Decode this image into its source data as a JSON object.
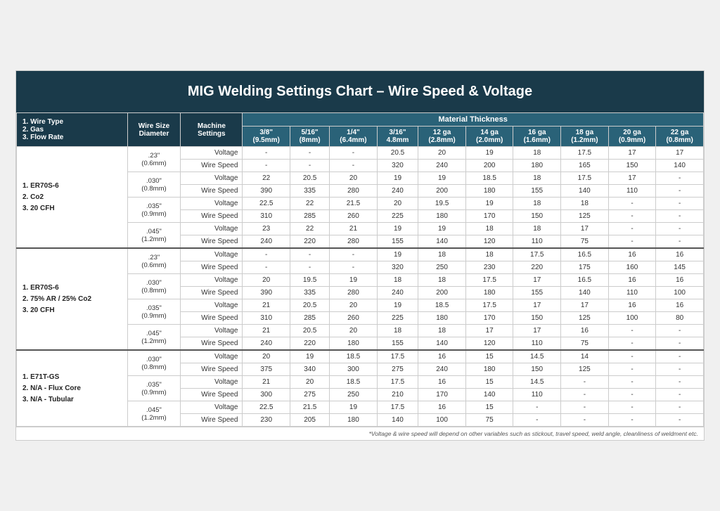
{
  "title": "MIG Welding Settings Chart – Wire Speed & Voltage",
  "headers": {
    "col1": "1. Wire Type\n2. Gas\n3. Flow Rate",
    "col2_line1": "Wire Size",
    "col2_line2": "Diameter",
    "col3_line1": "Machine",
    "col3_line2": "Settings",
    "material_thickness": "Material Thickness",
    "thicknesses": [
      {
        "top": "3/8\"",
        "bottom": "(9.5mm)"
      },
      {
        "top": "5/16\"",
        "bottom": "(8mm)"
      },
      {
        "top": "1/4\"",
        "bottom": "(6.4mm)"
      },
      {
        "top": "3/16\"",
        "bottom": "4.8mm"
      },
      {
        "top": "12 ga",
        "bottom": "(2.8mm)"
      },
      {
        "top": "14 ga",
        "bottom": "(2.0mm)"
      },
      {
        "top": "16 ga",
        "bottom": "(1.6mm)"
      },
      {
        "top": "18 ga",
        "bottom": "(1.2mm)"
      },
      {
        "top": "20 ga",
        "bottom": "(0.9mm)"
      },
      {
        "top": "22 ga",
        "bottom": "(0.8mm)"
      }
    ]
  },
  "sections": [
    {
      "wire_label": "1. ER70S-6\n\n2. Co2\n\n3. 20 CFH",
      "sizes": [
        {
          "size": ".23\"",
          "size2": "(0.6mm)",
          "rows": [
            {
              "label": "Voltage",
              "vals": [
                "-",
                "-",
                "-",
                "20.5",
                "20",
                "19",
                "18",
                "17.5",
                "17",
                "17"
              ]
            },
            {
              "label": "Wire Speed",
              "vals": [
                "-",
                "-",
                "-",
                "320",
                "240",
                "200",
                "180",
                "165",
                "150",
                "140"
              ]
            }
          ]
        },
        {
          "size": ".030\"",
          "size2": "(0.8mm)",
          "rows": [
            {
              "label": "Voltage",
              "vals": [
                "22",
                "20.5",
                "20",
                "19",
                "19",
                "18.5",
                "18",
                "17.5",
                "17",
                "-"
              ]
            },
            {
              "label": "Wire Speed",
              "vals": [
                "390",
                "335",
                "280",
                "240",
                "200",
                "180",
                "155",
                "140",
                "110",
                "-"
              ]
            }
          ]
        },
        {
          "size": ".035\"",
          "size2": "(0.9mm)",
          "rows": [
            {
              "label": "Voltage",
              "vals": [
                "22.5",
                "22",
                "21.5",
                "20",
                "19.5",
                "19",
                "18",
                "18",
                "-",
                "-"
              ]
            },
            {
              "label": "Wire Speed",
              "vals": [
                "310",
                "285",
                "260",
                "225",
                "180",
                "170",
                "150",
                "125",
                "-",
                "-"
              ]
            }
          ]
        },
        {
          "size": ".045\"",
          "size2": "(1.2mm)",
          "rows": [
            {
              "label": "Voltage",
              "vals": [
                "23",
                "22",
                "21",
                "19",
                "19",
                "18",
                "18",
                "17",
                "-",
                "-"
              ]
            },
            {
              "label": "Wire Speed",
              "vals": [
                "240",
                "220",
                "280",
                "155",
                "140",
                "120",
                "110",
                "75",
                "-",
                "-"
              ]
            }
          ]
        }
      ]
    },
    {
      "wire_label": "1. ER70S-6\n\n2. 75% AR / 25% Co2\n\n3. 20 CFH",
      "sizes": [
        {
          "size": ".23\"",
          "size2": "(0.6mm)",
          "rows": [
            {
              "label": "Voltage",
              "vals": [
                "-",
                "-",
                "-",
                "19",
                "18",
                "18",
                "17.5",
                "16.5",
                "16",
                "16"
              ]
            },
            {
              "label": "Wire Speed",
              "vals": [
                "-",
                "-",
                "-",
                "320",
                "250",
                "230",
                "220",
                "175",
                "160",
                "145"
              ]
            }
          ]
        },
        {
          "size": ".030\"",
          "size2": "(0.8mm)",
          "rows": [
            {
              "label": "Voltage",
              "vals": [
                "20",
                "19.5",
                "19",
                "18",
                "18",
                "17.5",
                "17",
                "16.5",
                "16",
                "16"
              ]
            },
            {
              "label": "Wire Speed",
              "vals": [
                "390",
                "335",
                "280",
                "240",
                "200",
                "180",
                "155",
                "140",
                "110",
                "100"
              ]
            }
          ]
        },
        {
          "size": ".035\"",
          "size2": "(0.9mm)",
          "rows": [
            {
              "label": "Voltage",
              "vals": [
                "21",
                "20.5",
                "20",
                "19",
                "18.5",
                "17.5",
                "17",
                "17",
                "16",
                "16"
              ]
            },
            {
              "label": "Wire Speed",
              "vals": [
                "310",
                "285",
                "260",
                "225",
                "180",
                "170",
                "150",
                "125",
                "100",
                "80"
              ]
            }
          ]
        },
        {
          "size": ".045\"",
          "size2": "(1.2mm)",
          "rows": [
            {
              "label": "Voltage",
              "vals": [
                "21",
                "20.5",
                "20",
                "18",
                "18",
                "17",
                "17",
                "16",
                "-",
                "-"
              ]
            },
            {
              "label": "Wire Speed",
              "vals": [
                "240",
                "220",
                "180",
                "155",
                "140",
                "120",
                "110",
                "75",
                "-",
                "-"
              ]
            }
          ]
        }
      ]
    },
    {
      "wire_label": "1. E71T-GS\n\n2. N/A - Flux Core\n\n3. N/A - Tubular",
      "sizes": [
        {
          "size": ".030\"",
          "size2": "(0.8mm)",
          "rows": [
            {
              "label": "Voltage",
              "vals": [
                "20",
                "19",
                "18.5",
                "17.5",
                "16",
                "15",
                "14.5",
                "14",
                "-",
                "-"
              ]
            },
            {
              "label": "Wire Speed",
              "vals": [
                "375",
                "340",
                "300",
                "275",
                "240",
                "180",
                "150",
                "125",
                "-",
                "-"
              ]
            }
          ]
        },
        {
          "size": ".035\"",
          "size2": "(0.9mm)",
          "rows": [
            {
              "label": "Voltage",
              "vals": [
                "21",
                "20",
                "18.5",
                "17.5",
                "16",
                "15",
                "14.5",
                "-",
                "-",
                "-"
              ]
            },
            {
              "label": "Wire Speed",
              "vals": [
                "300",
                "275",
                "250",
                "210",
                "170",
                "140",
                "110",
                "-",
                "-",
                "-"
              ]
            }
          ]
        },
        {
          "size": ".045\"",
          "size2": "(1.2mm)",
          "rows": [
            {
              "label": "Voltage",
              "vals": [
                "22.5",
                "21.5",
                "19",
                "17.5",
                "16",
                "15",
                "-",
                "-",
                "-",
                "-"
              ]
            },
            {
              "label": "Wire Speed",
              "vals": [
                "230",
                "205",
                "180",
                "140",
                "100",
                "75",
                "-",
                "-",
                "-",
                "-"
              ]
            }
          ]
        }
      ]
    }
  ],
  "footnote": "*Voltage & wire speed will depend on other variables such as stickout, travel speed, weld angle, cleanliness of weldment etc."
}
